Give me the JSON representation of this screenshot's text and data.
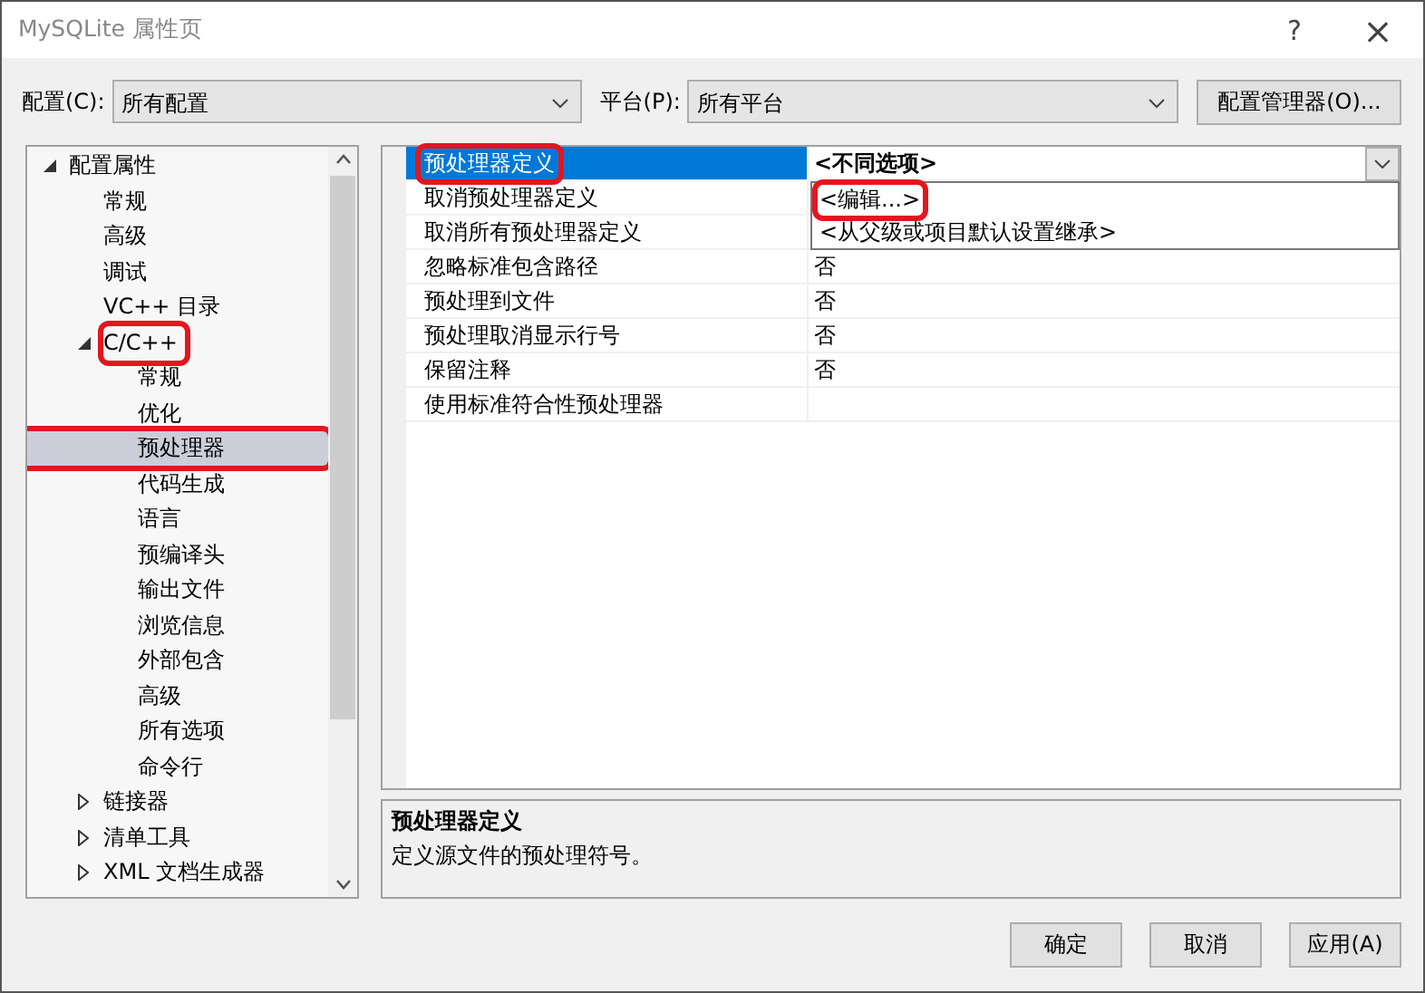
{
  "window": {
    "title": "MySQLite 属性页",
    "help": "?",
    "close": "×"
  },
  "config": {
    "label": "配置(C):",
    "value": "所有配置"
  },
  "platform": {
    "label": "平台(P):",
    "value": "所有平台"
  },
  "config_manager_button": "配置管理器(O)...",
  "tree": {
    "items": [
      {
        "label": "配置属性",
        "expanded": true,
        "selected": false,
        "highlighted": false,
        "children": [
          {
            "label": "常规",
            "selected": false,
            "highlighted": false
          },
          {
            "label": "高级",
            "selected": false,
            "highlighted": false
          },
          {
            "label": "调试",
            "selected": false,
            "highlighted": false
          },
          {
            "label": "VC++ 目录",
            "selected": false,
            "highlighted": false
          },
          {
            "label": "C/C++",
            "expanded": true,
            "selected": false,
            "highlighted": true,
            "children": [
              {
                "label": "常规",
                "selected": false,
                "highlighted": false
              },
              {
                "label": "优化",
                "selected": false,
                "highlighted": false
              },
              {
                "label": "预处理器",
                "selected": true,
                "highlighted": true
              },
              {
                "label": "代码生成",
                "selected": false,
                "highlighted": false
              },
              {
                "label": "语言",
                "selected": false,
                "highlighted": false
              },
              {
                "label": "预编译头",
                "selected": false,
                "highlighted": false
              },
              {
                "label": "输出文件",
                "selected": false,
                "highlighted": false
              },
              {
                "label": "浏览信息",
                "selected": false,
                "highlighted": false
              },
              {
                "label": "外部包含",
                "selected": false,
                "highlighted": false
              },
              {
                "label": "高级",
                "selected": false,
                "highlighted": false
              },
              {
                "label": "所有选项",
                "selected": false,
                "highlighted": false
              },
              {
                "label": "命令行",
                "selected": false,
                "highlighted": false
              }
            ]
          },
          {
            "label": "链接器",
            "expanded": false,
            "selected": false,
            "highlighted": false
          },
          {
            "label": "清单工具",
            "expanded": false,
            "selected": false,
            "highlighted": false
          },
          {
            "label": "XML 文档生成器",
            "expanded": false,
            "selected": false,
            "highlighted": false
          }
        ]
      }
    ]
  },
  "grid": {
    "rows": [
      {
        "name": "预处理器定义",
        "value": "<不同选项>",
        "selected": true,
        "highlighted": true
      },
      {
        "name": "取消预处理器定义",
        "selected": false,
        "highlighted": false
      },
      {
        "name": "取消所有预处理器定义",
        "selected": false,
        "highlighted": false
      },
      {
        "name": "忽略标准包含路径",
        "value": "否",
        "selected": false,
        "highlighted": false
      },
      {
        "name": "预处理到文件",
        "value": "否",
        "selected": false,
        "highlighted": false
      },
      {
        "name": "预处理取消显示行号",
        "value": "否",
        "selected": false,
        "highlighted": false
      },
      {
        "name": "保留注释",
        "value": "否",
        "selected": false,
        "highlighted": false
      },
      {
        "name": "使用标准符合性预处理器",
        "selected": false,
        "highlighted": false
      }
    ],
    "dropdown": {
      "options": [
        {
          "label": "<编辑...>",
          "highlighted": true
        },
        {
          "label": "<从父级或项目默认设置继承>",
          "highlighted": false
        }
      ]
    }
  },
  "description": {
    "title": "预处理器定义",
    "text": "定义源文件的预处理符号。"
  },
  "buttons": [
    "确定",
    "取消",
    "应用(A)"
  ]
}
